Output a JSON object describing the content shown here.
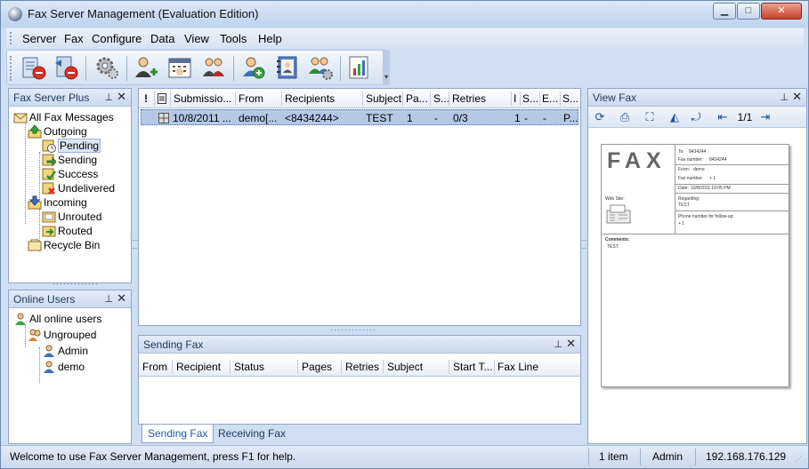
{
  "window": {
    "title": "Fax Server Management (Evaluation Edition)",
    "buttons": {
      "minimize": "▁",
      "maximize": "□",
      "close": "✕"
    }
  },
  "menu": [
    "Server",
    "Fax",
    "Configure",
    "Data",
    "View",
    "Tools",
    "Help"
  ],
  "toolbar": {
    "buttons": [
      {
        "name": "disconnect-server-button",
        "icon": "server-disconnect-icon"
      },
      {
        "name": "disconnect-all-button",
        "icon": "server-stop-icon"
      },
      {
        "name": "configure-button",
        "icon": "gears-icon"
      },
      {
        "name": "add-user-button",
        "icon": "add-user-icon"
      },
      {
        "name": "schedule-button",
        "icon": "calendar-icon"
      },
      {
        "name": "users-button",
        "icon": "users-icon"
      },
      {
        "name": "new-user-button",
        "icon": "user-plus-icon"
      },
      {
        "name": "address-book-button",
        "icon": "address-book-icon"
      },
      {
        "name": "user-settings-button",
        "icon": "user-gear-icon"
      },
      {
        "name": "report-button",
        "icon": "chart-report-icon"
      }
    ]
  },
  "fax_server_plus": {
    "title": "Fax Server Plus",
    "pin": "⊥",
    "close": "✕",
    "tree": {
      "all": "All Fax Messages",
      "outgoing": "Outgoing",
      "pending": "Pending",
      "sending": "Sending",
      "success": "Success",
      "undelivered": "Undelivered",
      "incoming": "Incoming",
      "unrouted": "Unrouted",
      "routed": "Routed",
      "recycle": "Recycle Bin"
    }
  },
  "online_users": {
    "title": "Online Users",
    "all": "All online users",
    "ungrouped": "Ungrouped",
    "users": [
      "Admin",
      "demo"
    ]
  },
  "fax_list": {
    "headers": {
      "priority": "!",
      "attach": "",
      "submission": "Submissio...",
      "from": "From",
      "recipients": "Recipients",
      "subject": "Subject",
      "pages": "Pa...",
      "s1": "S...",
      "retries": "Retries",
      "i": "I",
      "s2": "S...",
      "e": "E...",
      "s3": "S..."
    },
    "row": {
      "submission": "10/8/2011 ...",
      "from": "demo[...",
      "recipients": "<8434244>",
      "subject": "TEST",
      "pages": "1",
      "s1": "-",
      "retries": "0/3",
      "i": "1",
      "s2": "-",
      "e": "-",
      "s3": "P..."
    }
  },
  "sending_fax": {
    "title": "Sending Fax",
    "headers": [
      "From",
      "Recipient",
      "Status",
      "Pages",
      "Retries",
      "Subject",
      "Start T...",
      "Fax Line"
    ]
  },
  "tabs": [
    "Sending Fax",
    "Receiving Fax"
  ],
  "view_fax": {
    "title": "View Fax",
    "page_indicator": "1/1",
    "fax": {
      "heading": "FAX",
      "to_label": "To:",
      "to_value": "8434244",
      "fax_number_label": "Fax number:",
      "fax_number_value": "8434244",
      "from_label": "From:",
      "from_value": "demo",
      "from_fax_label": "Fax number:",
      "from_fax_value": "+ 1",
      "date_label": "Date:",
      "date_value": "10/8/2011 10:05 PM",
      "regarding_label": "Regarding:",
      "regarding_value": "TEST",
      "phone_label": "Phone number for follow-up:",
      "phone_value": "+ 1",
      "web_site_label": "Web Site:",
      "comments_label": "Comments:",
      "comments_value": "TEST"
    }
  },
  "status_bar": {
    "message": "Welcome to use Fax Server Management, press F1 for help.",
    "items": "1 item",
    "user": "Admin",
    "ip": "192.168.176.129"
  }
}
